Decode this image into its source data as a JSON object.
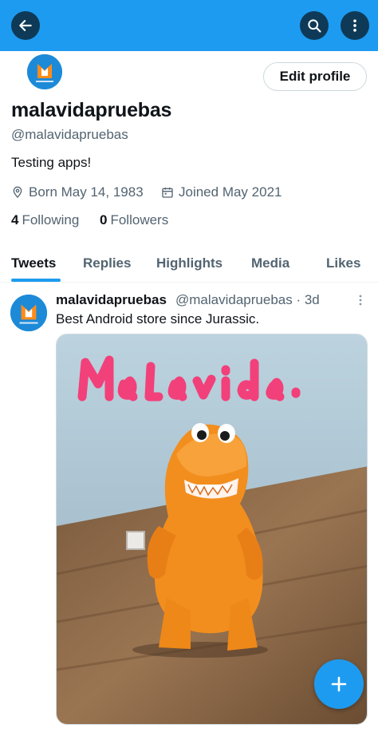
{
  "header": {
    "back_icon": "arrow-left-icon",
    "search_icon": "search-icon",
    "more_icon": "more-vertical-icon",
    "color": "#1d9bf0"
  },
  "profile": {
    "edit_label": "Edit profile",
    "display_name": "malavidapruebas",
    "handle": "@malavidapruebas",
    "bio": "Testing apps!",
    "born": "Born May 14, 1983",
    "joined": "Joined May 2021",
    "following_count": "4",
    "following_label": "Following",
    "followers_count": "0",
    "followers_label": "Followers"
  },
  "tabs": [
    {
      "label": "Tweets",
      "active": true
    },
    {
      "label": "Replies",
      "active": false
    },
    {
      "label": "Highlights",
      "active": false
    },
    {
      "label": "Media",
      "active": false
    },
    {
      "label": "Likes",
      "active": false
    }
  ],
  "tweet": {
    "name": "malavidapruebas",
    "handle_time": "@malavidapruebas · 3d",
    "text": "Best Android store since Jurassic.",
    "image_handwriting": "Malavida",
    "image_subject": "orange-toy-dinosaur"
  },
  "fab": {
    "icon": "plus-icon"
  }
}
